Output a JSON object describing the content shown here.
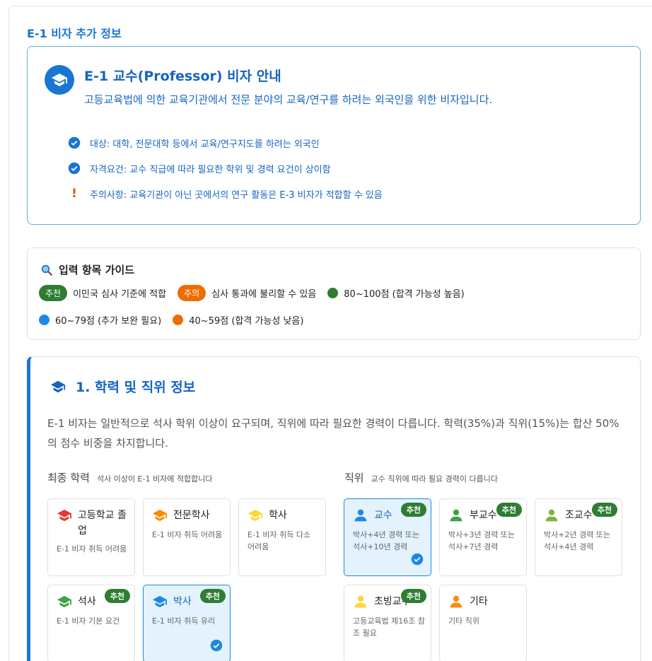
{
  "page": {
    "section_title": "E-1 비자 추가 정보"
  },
  "info": {
    "title": "E-1 교수(Professor) 비자 안내",
    "description": "고등교육법에 의한 교육기관에서 전문 분야의 교육/연구를 하려는 외국인을 위한 비자입니다.",
    "items": [
      {
        "icon": "check-circle-icon",
        "text": "대상: 대학, 전문대학 등에서 교육/연구지도를 하려는 외국인"
      },
      {
        "icon": "check-circle-icon",
        "text": "자격요건: 교수 직급에 따라 필요한 학위 및 경력 요건이 상이함"
      },
      {
        "icon": "exclamation-icon",
        "text": "주의사항: 교육기관이 아닌 곳에서의 연구 활동은 E-3 비자가 적합할 수 있음"
      }
    ]
  },
  "guide": {
    "title": "입력 항목 가이드",
    "recommend_chip": "추천",
    "recommend_text": "이민국 심사 기준에 적합",
    "caution_chip": "주의",
    "caution_text": "심사 통과에 불리할 수 있음",
    "score_high": "80~100점 (합격 가능성 높음)",
    "score_mid": "60~79점 (추가 보완 필요)",
    "score_low": "40~59점 (합격 가능성 낮음)",
    "colors": {
      "high": "#2e7d32",
      "mid": "#1e88e5",
      "low": "#ef6c00"
    }
  },
  "section1": {
    "title": "1. 학력 및 직위 정보",
    "description": "E-1 비자는 일반적으로 석사 학위 이상이 요구되며, 직위에 따라 필요한 경력이 다릅니다. 학력(35%)과 직위(15%)는 합산 50%의 점수 비중을 차지합니다.",
    "education": {
      "label": "최종 학력",
      "sub": "석사 이상이 E-1 비자에 적합합니다",
      "options": [
        {
          "name": "고등학교 졸업",
          "desc": "E-1 비자 취득 어려움",
          "icon_color": "#e53935",
          "badge": "",
          "selected": false
        },
        {
          "name": "전문학사",
          "desc": "E-1 비자 취득 어려움",
          "icon_color": "#fb8c00",
          "badge": "",
          "selected": false
        },
        {
          "name": "학사",
          "desc": "E-1 비자 취득 다소 어려움",
          "icon_color": "#fdd835",
          "badge": "",
          "selected": false
        },
        {
          "name": "석사",
          "desc": "E-1 비자 기본 요건",
          "icon_color": "#43a047",
          "badge": "추천",
          "selected": false
        },
        {
          "name": "박사",
          "desc": "E-1 비자 취득 유리",
          "icon_color": "#1e88e5",
          "badge": "추천",
          "selected": true
        }
      ]
    },
    "position": {
      "label": "직위",
      "sub": "교수 직위에 따라 필요 경력이 다릅니다",
      "options": [
        {
          "name": "교수",
          "desc": "박사+4년 경력 또는 석사+10년 경력",
          "icon_color": "#1e88e5",
          "badge": "추천",
          "selected": true
        },
        {
          "name": "부교수",
          "desc": "박사+3년 경력 또는 석사+7년 경력",
          "icon_color": "#43a047",
          "badge": "추천",
          "selected": false
        },
        {
          "name": "조교수",
          "desc": "박사+2년 경력 또는 석사+4년 경력",
          "icon_color": "#7cb342",
          "badge": "추천",
          "selected": false
        },
        {
          "name": "초빙교수",
          "desc": "고등교육법 제16조 참조 필요",
          "icon_color": "#fdd835",
          "badge": "추천",
          "selected": false
        },
        {
          "name": "기타",
          "desc": "기타 직위",
          "icon_color": "#fb8c00",
          "badge": "",
          "selected": false
        }
      ]
    }
  }
}
